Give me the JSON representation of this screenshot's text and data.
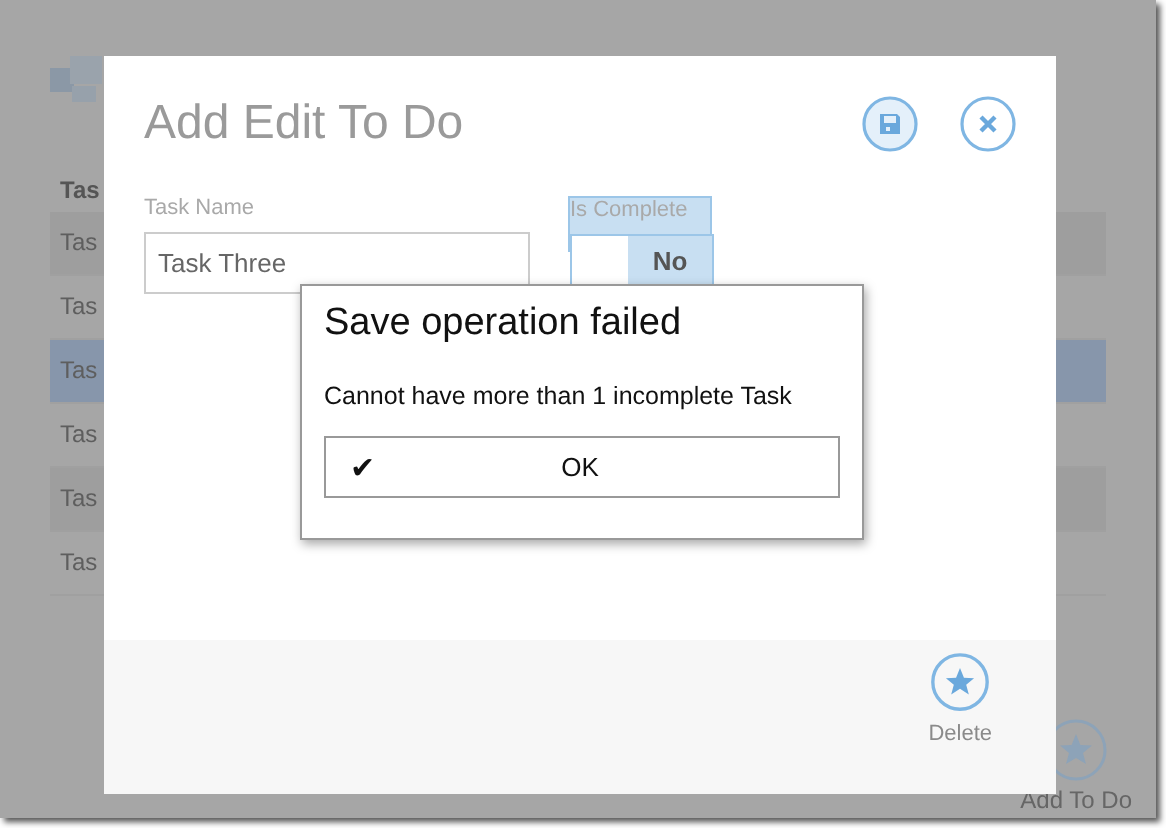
{
  "background": {
    "header": "Tas",
    "rows": [
      {
        "label": "Tas",
        "selected": false
      },
      {
        "label": "Tas",
        "selected": false
      },
      {
        "label": "Tas",
        "selected": true
      },
      {
        "label": "Tas",
        "selected": false
      },
      {
        "label": "Tas",
        "selected": false
      },
      {
        "label": "Tas",
        "selected": false
      }
    ],
    "add_button": "Add To Do"
  },
  "dialog": {
    "title": "Add Edit To Do",
    "fields": [
      {
        "kind": "text",
        "label": "Task Name",
        "value": "Task Three"
      },
      {
        "kind": "toggle",
        "label": "Is Complete",
        "on": false,
        "value": "No"
      }
    ],
    "footer_button": "Delete"
  },
  "alert": {
    "title": "Save operation failed",
    "message": "Cannot have more than 1 incomplete Task",
    "button": "✔",
    "button_label": "OK"
  }
}
